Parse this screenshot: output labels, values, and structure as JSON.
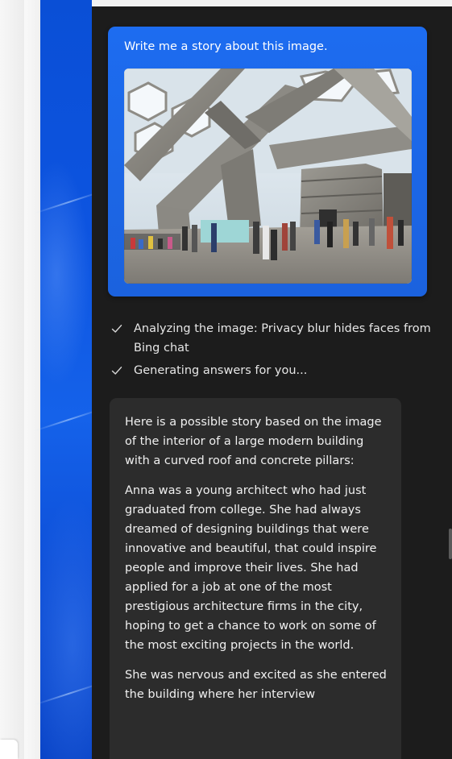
{
  "prompt": {
    "text": "Write me a story about this image."
  },
  "steps": [
    {
      "icon": "checkmark-icon",
      "label": "Analyzing the image: Privacy blur hides faces from Bing chat"
    },
    {
      "icon": "checkmark-icon",
      "label": "Generating answers for you..."
    }
  ],
  "answer": {
    "paragraphs": [
      "Here is a possible story based on the image of the interior of a large modern building with a curved roof and concrete pillars:",
      "Anna was a young architect who had just graduated from college. She had always dreamed of designing buildings that were innovative and beautiful, that could inspire people and improve their lives. She had applied for a job at one of the most prestigious architecture firms in the city, hoping to get a chance to work on some of the most exciting projects in the world.",
      "She was nervous and excited as she entered the building where her interview"
    ]
  },
  "colors": {
    "accent": "#1d6cf0",
    "panel": "#1c1c1c",
    "answer_bubble": "#2c2c2c"
  }
}
